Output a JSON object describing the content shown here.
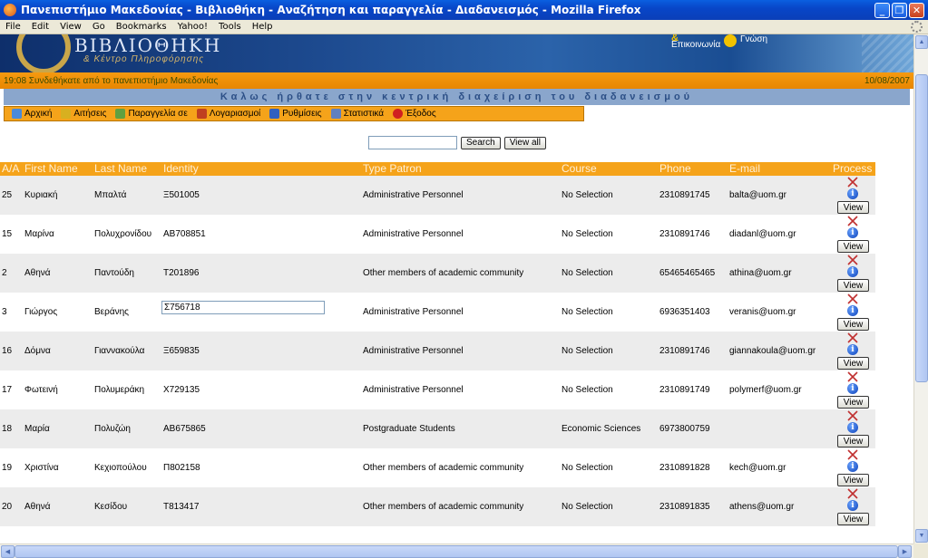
{
  "window": {
    "title": "Πανεπιστήμιο Μακεδονίας - Βιβλιοθήκη - Αναζήτηση και παραγγελία - Διαδανεισμός - Mozilla Firefox",
    "minimize": "_",
    "maximize": "❐",
    "close": "✕"
  },
  "menubar": [
    "File",
    "Edit",
    "View",
    "Go",
    "Bookmarks",
    "Yahoo!",
    "Tools",
    "Help"
  ],
  "banner": {
    "library_title": "ΒΙΒΛΙΟΘΗΚΗ",
    "library_subtitle": "& Κέντρο Πληροφόρησης",
    "tag_amp": "&",
    "tag_left": "Επικοινωνία",
    "tag_right": "Γνώση"
  },
  "status": {
    "login_text": "19:08 Συνδεθήκατε από το πανεπιστήμιο Μακεδονίας",
    "date": "10/08/2007"
  },
  "welcome_text": "Καλως ήρθατε στην κεντρική διαχείριση του διαδανεισμού",
  "nav": [
    {
      "label": "Αρχική",
      "color": "#4a8ad8"
    },
    {
      "label": "Αιτήσεις",
      "color": "#d8b020"
    },
    {
      "label": "Παραγγελία σε",
      "color": "#60a040"
    },
    {
      "label": "Λογαριασμοί",
      "color": "#c04020"
    },
    {
      "label": "Ρυθμίσεις",
      "color": "#3060c0"
    },
    {
      "label": "Στατιστικά",
      "color": "#6080c0"
    },
    {
      "label": "Έξοδος",
      "color": "#d02020"
    }
  ],
  "search": {
    "value": "",
    "search_label": "Search",
    "viewall_label": "View all"
  },
  "table": {
    "headers": {
      "aa": "A/A",
      "first": "First Name",
      "last": "Last Name",
      "identity": "Identity",
      "type": "Type Patron",
      "course": "Course",
      "phone": "Phone",
      "email": "E-mail",
      "process": "Process"
    },
    "view_label": "View",
    "rows": [
      {
        "aa": "25",
        "first": "Κυριακή",
        "last": "Μπαλτά",
        "identity": "Ξ501005",
        "type": "Administrative Personnel",
        "course": "No Selection",
        "phone": "2310891745",
        "email": "balta@uom.gr"
      },
      {
        "aa": "15",
        "first": "Μαρίνα",
        "last": "Πολυχρονίδου",
        "identity": "ΑΒ708851",
        "type": "Administrative Personnel",
        "course": "No Selection",
        "phone": "2310891746",
        "email": "diadanl@uom.gr"
      },
      {
        "aa": "2",
        "first": "Αθηνά",
        "last": "Παντούδη",
        "identity": "Τ201896",
        "type": "Other members of academic community",
        "course": "No Selection",
        "phone": "65465465465",
        "email": "athina@uom.gr"
      },
      {
        "aa": "3",
        "first": "Γιώργος",
        "last": "Βεράνης",
        "identity": "Σ756718",
        "type": "Administrative Personnel",
        "course": "No Selection",
        "phone": "6936351403",
        "email": "veranis@uom.gr"
      },
      {
        "aa": "16",
        "first": "Δόμνα",
        "last": "Γιαννακούλα",
        "identity": "Ξ659835",
        "type": "Administrative Personnel",
        "course": "No Selection",
        "phone": "2310891746",
        "email": "giannakoula@uom.gr"
      },
      {
        "aa": "17",
        "first": "Φωτεινή",
        "last": "Πολυμεράκη",
        "identity": "Χ729135",
        "type": "Administrative Personnel",
        "course": "No Selection",
        "phone": "2310891749",
        "email": "polymerf@uom.gr"
      },
      {
        "aa": "18",
        "first": "Μαρία",
        "last": "Πολυζώη",
        "identity": "ΑΒ675865",
        "type": "Postgraduate Students",
        "course": "Economic Sciences",
        "phone": "6973800759",
        "email": ""
      },
      {
        "aa": "19",
        "first": "Χριστίνα",
        "last": "Κεχιοπούλου",
        "identity": "Π802158",
        "type": "Other members of academic community",
        "course": "No Selection",
        "phone": "2310891828",
        "email": "kech@uom.gr"
      },
      {
        "aa": "20",
        "first": "Αθηνά",
        "last": "Κεσίδου",
        "identity": "Τ813417",
        "type": "Other members of academic community",
        "course": "No Selection",
        "phone": "2310891835",
        "email": "athens@uom.gr"
      }
    ]
  },
  "colors": {
    "accent_orange": "#f5a31a",
    "welcome_bar": "#8aa6cc",
    "titlebar_blue": "#0846c8"
  }
}
